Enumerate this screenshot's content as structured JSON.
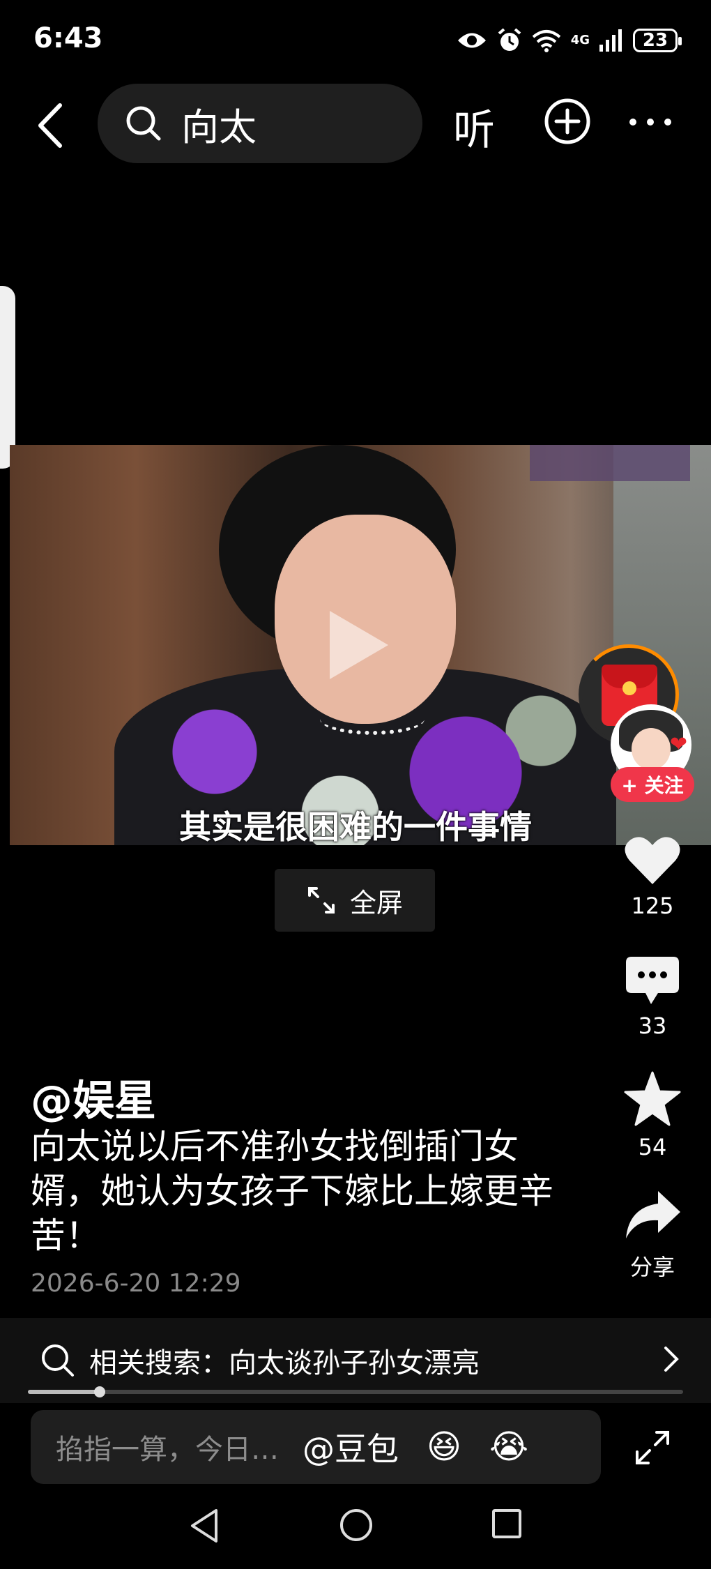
{
  "status_bar": {
    "time": "6:43",
    "network": "4G",
    "battery": "23"
  },
  "header": {
    "search_query": "向太",
    "listen_label": "听"
  },
  "video": {
    "caption": "其实是很困难的一件事情",
    "fullscreen_label": "全屏"
  },
  "rail": {
    "follow_label": "+ 关注",
    "likes": "125",
    "comments": "33",
    "favorites": "54",
    "share_label": "分享"
  },
  "post": {
    "author": "@娱星",
    "description": "向太说以后不准孙女找倒插门女婿，她认为女孩子下嫁比上嫁更辛苦！",
    "date": "2026-6-20 12:29"
  },
  "related": {
    "text": "相关搜索：向太谈孙子孙女漂亮"
  },
  "playback": {
    "progress_fraction": 0.11
  },
  "input": {
    "placeholder": "掐指一算，今日…",
    "mention": "@豆包",
    "emoji_1": "😆",
    "emoji_2": "😭"
  },
  "colors": {
    "accent_red": "#f0364a",
    "background": "#000000",
    "muted_text": "#8a8a8a"
  }
}
